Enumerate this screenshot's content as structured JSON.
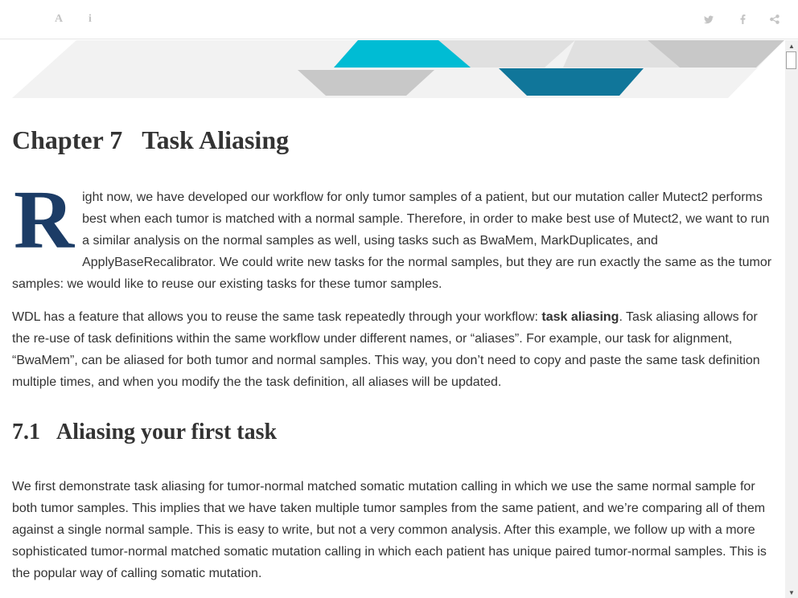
{
  "toolbar": {
    "font_button_glyph": "A",
    "info_button_glyph": "i",
    "icons": [
      "font-settings-icon",
      "info-icon",
      "twitter-icon",
      "facebook-icon",
      "share-icon"
    ]
  },
  "banner": {
    "colors": {
      "background": "#f2f2f2",
      "light_gray": "#e0e0e0",
      "mid_gray": "#c8c8c8",
      "cyan": "#00bcd4",
      "teal": "#10769a"
    }
  },
  "chapter": {
    "number": "Chapter 7",
    "title": "Task Aliasing"
  },
  "paragraph1": {
    "dropcap": "R",
    "text": "ight now, we have developed our workflow for only tumor samples of a patient, but our mutation caller Mutect2 performs best when each tumor is matched with a normal sample. Therefore, in order to make best use of Mutect2, we want to run a similar analysis on the normal samples as well, using tasks such as BwaMem, MarkDuplicates, and ApplyBaseRecalibrator. We could write new tasks for the normal samples, but they are run exactly the same as the tumor samples: we would like to reuse our existing tasks for these tumor samples."
  },
  "paragraph2": {
    "before": "WDL has a feature that allows you to reuse the same task repeatedly through your workflow: ",
    "bold": "task aliasing",
    "after": ". Task aliasing allows for the re-use of task definitions within the same workflow under different names, or “aliases”. For example, our task for alignment, “BwaMem”, can be aliased for both tumor and normal samples. This way, you don’t need to copy and paste the same task definition multiple times, and when you modify the the task definition, all aliases will be updated."
  },
  "section": {
    "number": "7.1",
    "title": "Aliasing your first task"
  },
  "paragraph3": {
    "text": "We first demonstrate task aliasing for tumor-normal matched somatic mutation calling in which we use the same normal sample for both tumor samples. This implies that we have taken multiple tumor samples from the same patient, and we’re comparing all of them against a single normal sample. This is easy to write, but not a very common analysis. After this example, we follow up with a more sophisticated tumor-normal matched somatic mutation calling in which each patient has unique paired tumor-normal samples. This is the popular way of calling somatic mutation."
  },
  "colors": {
    "dropcap": "#1c3c66",
    "text": "#333333",
    "toolbar_icon": "#c4c4c4"
  }
}
